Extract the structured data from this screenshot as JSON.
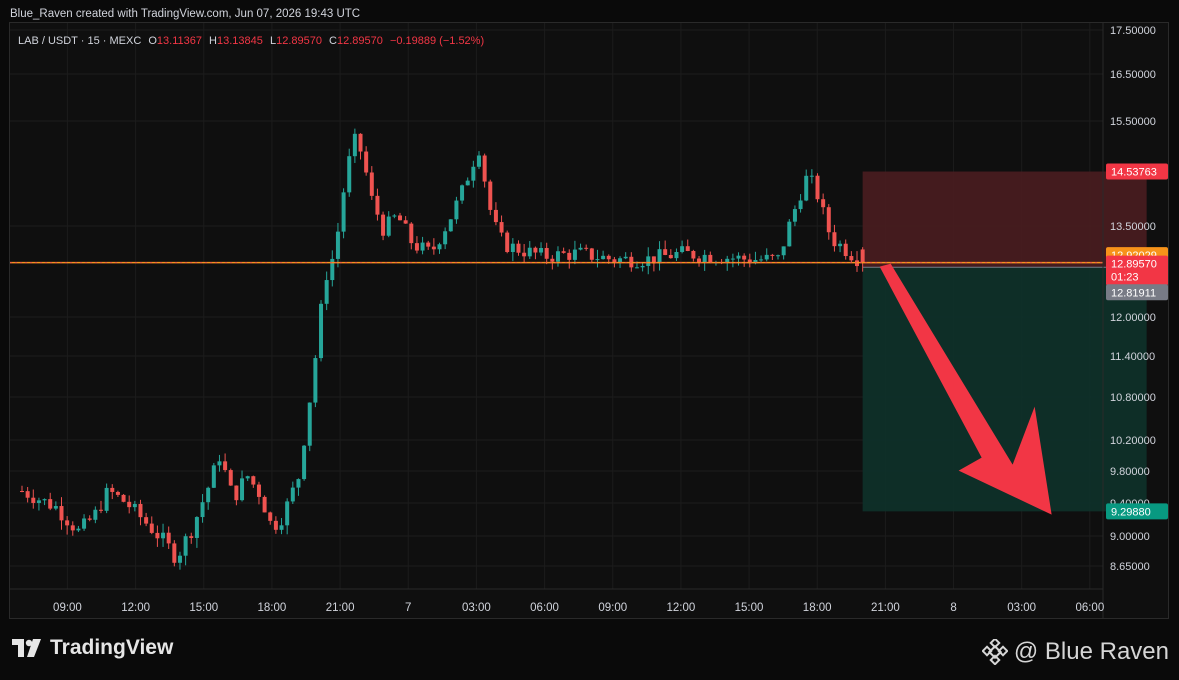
{
  "header": {
    "created_by": "Blue_Raven created with TradingView.com, Jun 07, 2026 19:43 UTC"
  },
  "legend": {
    "symbol": "LAB / USDT · 15 · MEXC",
    "o_label": "O",
    "o": "13.11367",
    "h_label": "H",
    "h": "13.13845",
    "l_label": "L",
    "l": "12.89570",
    "c_label": "C",
    "c": "12.89570",
    "change": "−0.19889 (−1.52%)"
  },
  "colors": {
    "up": "#26a69a",
    "down": "#ef5350",
    "stop_zone": "#4a1d20",
    "target_zone": "#0f3029",
    "current_line": "#f7931a",
    "arrow": "#f23645",
    "grid": "#1c1c1c",
    "axis_text": "#d1d4dc"
  },
  "chart_data": {
    "type": "candlestick",
    "price_axis": [
      "17.50000",
      "16.50000",
      "15.50000",
      "13.50000",
      "12.00000",
      "11.40000",
      "10.80000",
      "10.20000",
      "9.80000",
      "9.40000",
      "9.00000",
      "8.65000"
    ],
    "time_axis": [
      "09:00",
      "12:00",
      "15:00",
      "18:00",
      "21:00",
      "7",
      "03:00",
      "06:00",
      "09:00",
      "12:00",
      "15:00",
      "18:00",
      "21:00",
      "8",
      "03:00",
      "06:00"
    ],
    "time_index": [
      2,
      5,
      8,
      11,
      14,
      17,
      20,
      23,
      26,
      29,
      32,
      35,
      38,
      41,
      44,
      47
    ],
    "x_range": [
      0,
      50
    ],
    "price_labels": [
      {
        "value": 14.53763,
        "text": "14.53763",
        "color": "#f23645"
      },
      {
        "value": 12.92029,
        "text": "12.92029",
        "color": "#f7931a"
      },
      {
        "value": 12.8957,
        "text": "12.89570",
        "sub": "01:23",
        "color": "#f23645"
      },
      {
        "value": 12.81911,
        "text": "12.81911",
        "color": "#787b86"
      },
      {
        "value": 9.2988,
        "text": "9.29880",
        "color": "#089981"
      }
    ],
    "position": {
      "entry": 12.81911,
      "stop": 14.53763,
      "target": 9.2988,
      "x_start": 37,
      "x_end": 49.5
    },
    "current_price": 12.8957,
    "anchors": [
      [
        0,
        9.55
      ],
      [
        1.5,
        9.35
      ],
      [
        2.5,
        9.05
      ],
      [
        3.2,
        9.25
      ],
      [
        3.8,
        9.55
      ],
      [
        4.6,
        9.4
      ],
      [
        5.5,
        9.15
      ],
      [
        6.2,
        8.95
      ],
      [
        6.8,
        8.75
      ],
      [
        7.5,
        9.1
      ],
      [
        8.2,
        9.6
      ],
      [
        8.7,
        10.0
      ],
      [
        9.3,
        9.45
      ],
      [
        9.9,
        9.75
      ],
      [
        10.5,
        9.5
      ],
      [
        11,
        9.1
      ],
      [
        11.5,
        9.25
      ],
      [
        12.2,
        9.75
      ],
      [
        12.6,
        10.6
      ],
      [
        13.0,
        11.6
      ],
      [
        13.3,
        12.6
      ],
      [
        13.8,
        13.1
      ],
      [
        14.3,
        14.6
      ],
      [
        14.7,
        15.2
      ],
      [
        15.0,
        14.8
      ],
      [
        15.4,
        14.0
      ],
      [
        15.9,
        13.45
      ],
      [
        16.5,
        13.7
      ],
      [
        17.2,
        13.2
      ],
      [
        18.0,
        13.05
      ],
      [
        18.8,
        13.6
      ],
      [
        19.5,
        14.3
      ],
      [
        20.1,
        15.0
      ],
      [
        20.7,
        13.6
      ],
      [
        21.2,
        13.2
      ],
      [
        22.0,
        13.1
      ],
      [
        23.0,
        13.0
      ],
      [
        24.5,
        13.05
      ],
      [
        26.0,
        12.95
      ],
      [
        27.5,
        12.95
      ],
      [
        29.0,
        13.05
      ],
      [
        30.5,
        13.0
      ],
      [
        32.0,
        12.95
      ],
      [
        33.3,
        12.95
      ],
      [
        34.0,
        13.8
      ],
      [
        34.6,
        14.5
      ],
      [
        35.0,
        14.1
      ],
      [
        35.6,
        13.3
      ],
      [
        36.3,
        13.1
      ],
      [
        37,
        12.9
      ]
    ]
  },
  "footer": {
    "brand_left": "TradingView",
    "brand_right": "@ Blue Raven"
  }
}
